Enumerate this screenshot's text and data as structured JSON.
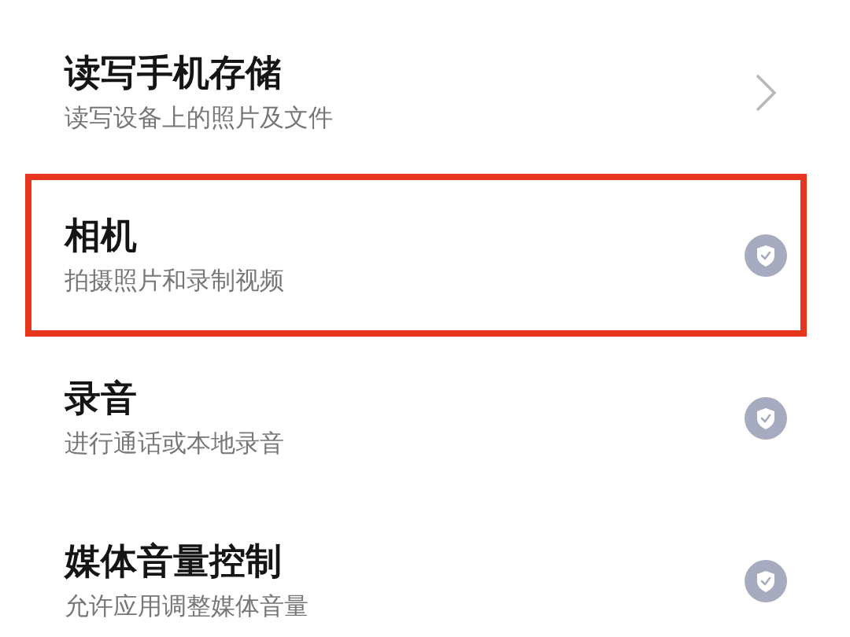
{
  "permissions": [
    {
      "title": "读写手机存储",
      "description": "读写设备上的照片及文件",
      "kind": "chevron",
      "highlighted": false
    },
    {
      "title": "相机",
      "description": "拍摄照片和录制视频",
      "kind": "shield",
      "highlighted": true
    },
    {
      "title": "录音",
      "description": "进行通话或本地录音",
      "kind": "shield",
      "highlighted": false
    },
    {
      "title": "媒体音量控制",
      "description": "允许应用调整媒体音量",
      "kind": "shield",
      "highlighted": false
    }
  ]
}
